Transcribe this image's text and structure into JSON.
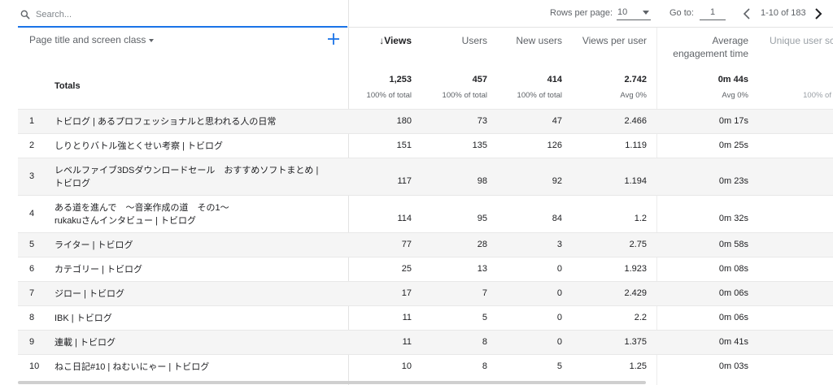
{
  "search": {
    "placeholder": "Search..."
  },
  "pagination": {
    "rows_per_page_label": "Rows per page:",
    "rows_per_page_value": "10",
    "goto_label": "Go to:",
    "goto_value": "1",
    "range_text": "1-10 of 183"
  },
  "header": {
    "dimension": "Page title and screen class",
    "columns": [
      {
        "label": "↓Views"
      },
      {
        "label": "Users"
      },
      {
        "label": "New users"
      },
      {
        "label": "Views per user"
      },
      {
        "label": "Average",
        "label2": "engagement time"
      },
      {
        "label": "Unique user sc"
      }
    ]
  },
  "totals": {
    "label": "Totals",
    "values": [
      "1,253",
      "457",
      "414",
      "2.742",
      "0m 44s"
    ],
    "subs": [
      "100% of total",
      "100% of total",
      "100% of total",
      "Avg 0%",
      "Avg 0%",
      "100% of"
    ]
  },
  "rows": [
    {
      "idx": "1",
      "name": "トビログ | あるプロフェッショナルと思われる人の日常",
      "name2": "",
      "views": "180",
      "users": "73",
      "new_users": "47",
      "vpu": "2.466",
      "aet": "0m 17s"
    },
    {
      "idx": "2",
      "name": "しりとりバトル強とくせい考察 | トビログ",
      "name2": "",
      "views": "151",
      "users": "135",
      "new_users": "126",
      "vpu": "1.119",
      "aet": "0m 25s"
    },
    {
      "idx": "3",
      "name": "レベルファイブ3DSダウンロードセール　おすすめソフトまとめ |",
      "name2": "トビログ",
      "views": "117",
      "users": "98",
      "new_users": "92",
      "vpu": "1.194",
      "aet": "0m 23s"
    },
    {
      "idx": "4",
      "name": "ある道を進んで　〜音楽作成の道　その1〜",
      "name2": "rukakuさんインタビュー | トビログ",
      "views": "114",
      "users": "95",
      "new_users": "84",
      "vpu": "1.2",
      "aet": "0m 32s"
    },
    {
      "idx": "5",
      "name": "ライター | トビログ",
      "name2": "",
      "views": "77",
      "users": "28",
      "new_users": "3",
      "vpu": "2.75",
      "aet": "0m 58s"
    },
    {
      "idx": "6",
      "name": "カテゴリー | トビログ",
      "name2": "",
      "views": "25",
      "users": "13",
      "new_users": "0",
      "vpu": "1.923",
      "aet": "0m 08s"
    },
    {
      "idx": "7",
      "name": "ジロー | トビログ",
      "name2": "",
      "views": "17",
      "users": "7",
      "new_users": "0",
      "vpu": "2.429",
      "aet": "0m 06s"
    },
    {
      "idx": "8",
      "name": "IBK | トビログ",
      "name2": "",
      "views": "11",
      "users": "5",
      "new_users": "0",
      "vpu": "2.2",
      "aet": "0m 06s"
    },
    {
      "idx": "9",
      "name": "連載 | トビログ",
      "name2": "",
      "views": "11",
      "users": "8",
      "new_users": "0",
      "vpu": "1.375",
      "aet": "0m 41s"
    },
    {
      "idx": "10",
      "name": "ねこ日記#10 | ねむいにゃー | トビログ",
      "name2": "",
      "views": "10",
      "users": "8",
      "new_users": "5",
      "vpu": "1.25",
      "aet": "0m 03s"
    }
  ],
  "colors": {
    "accent": "#1a73e8",
    "alt_row": "#f5f5f5"
  }
}
